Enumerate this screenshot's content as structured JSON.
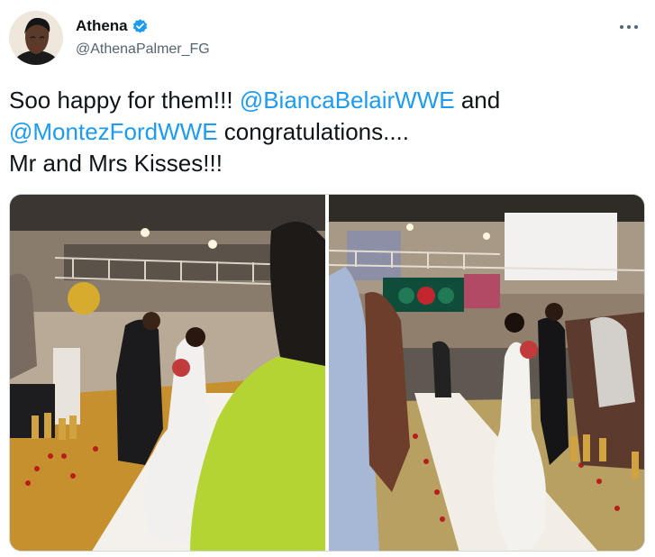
{
  "author": {
    "display_name": "Athena",
    "handle": "@AthenaPalmer_FG",
    "verified": true,
    "avatar_icon": "user-avatar"
  },
  "tweet": {
    "text_1": "Soo happy for them!!! ",
    "mention_1": "@BiancaBelairWWE",
    "text_2": "  and",
    "mention_2": "@MontezFordWWE",
    "text_3": "  congratulations....",
    "text_4": "Mr and Mrs Kisses!!!"
  },
  "media": {
    "count": 2,
    "items": [
      "wedding-aisle-photo-left",
      "wedding-aisle-photo-right"
    ]
  },
  "icons": {
    "verified": "verified-badge-icon",
    "more": "more-options-icon"
  },
  "colors": {
    "mention": "#1d9bf0",
    "verified": "#1d9bf0",
    "secondary_text": "#536471"
  }
}
